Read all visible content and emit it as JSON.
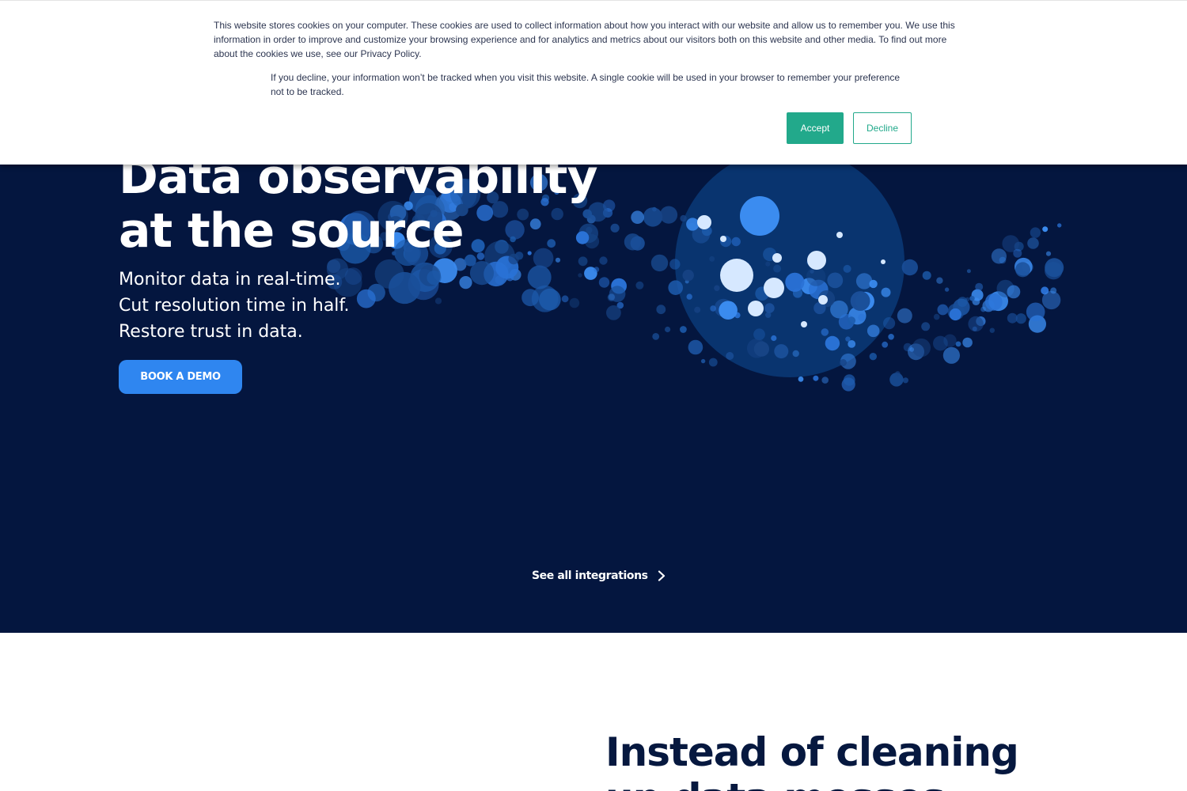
{
  "cookie_banner": {
    "text": "This website stores cookies on your computer. These cookies are used to collect information about how you interact with our website and allow us to remember you. We use this information in order to improve and customize your browsing experience and for analytics and metrics about our visitors both on this website and other media. To find out more about the cookies we use, see our Privacy Policy.",
    "decline_note": "If you decline, your information won’t be tracked when you visit this website. A single cookie will be used in your browser to remember your preference not to be tracked.",
    "accept_label": "Accept",
    "decline_label": "Decline"
  },
  "hero": {
    "title_lines": [
      "Data observability",
      "at the source"
    ],
    "subtitle_lines": [
      "Monitor data in real-time.",
      "Cut resolution time in half.",
      "Restore trust in data."
    ],
    "cta_label": "BOOK A DEMO",
    "integrations_link": "See all integrations"
  },
  "section2": {
    "title_lines": [
      "Instead of cleaning",
      "up data messes"
    ]
  },
  "colors": {
    "hero_bg": "#04163f",
    "accent_blue": "#2f86f0",
    "cookie_green": "#22a98b",
    "heading_navy": "#06183f"
  },
  "icons": {
    "integrations_arrow": "chevron-right-icon"
  }
}
